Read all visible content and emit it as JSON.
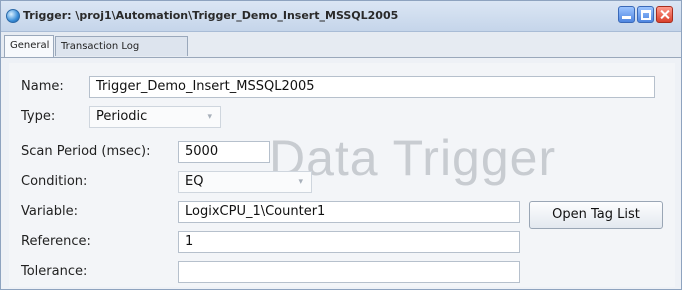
{
  "window": {
    "title": "Trigger: \\proj1\\Automation\\Trigger_Demo_Insert_MSSQL2005"
  },
  "tabs": [
    {
      "label": "General",
      "active": true
    },
    {
      "label": "Transaction Log",
      "active": false
    }
  ],
  "form": {
    "name_label": "Name:",
    "name_value": "Trigger_Demo_Insert_MSSQL2005",
    "type_label": "Type:",
    "type_value": "Periodic",
    "scan_label": "Scan Period (msec):",
    "scan_value": "5000",
    "condition_label": "Condition:",
    "condition_value": "EQ",
    "variable_label": "Variable:",
    "variable_value": "LogixCPU_1\\Counter1",
    "reference_label": "Reference:",
    "reference_value": "1",
    "tolerance_label": "Tolerance:",
    "tolerance_value": ""
  },
  "watermark": "Data Trigger",
  "buttons": {
    "open_tag_list": "Open Tag List"
  },
  "icons": {
    "dropdown_arrow": "▾"
  },
  "colors": {
    "titlebar": "#c5d5ea",
    "close_button": "#d9402c",
    "watermark": "#c8ccd1"
  }
}
